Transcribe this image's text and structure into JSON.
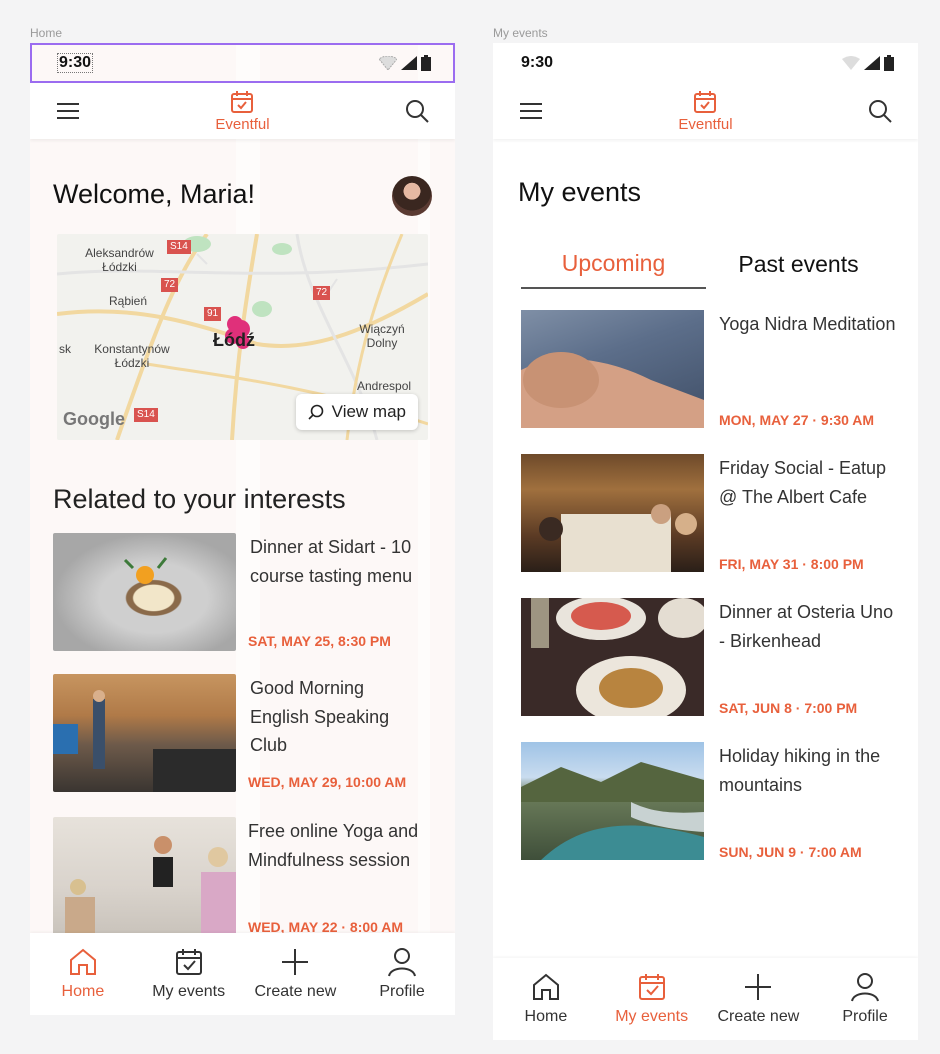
{
  "frames": {
    "home": "Home",
    "my_events": "My events"
  },
  "status": {
    "time": "9:30"
  },
  "app": {
    "name": "Eventful"
  },
  "home": {
    "welcome": "Welcome, Maria!",
    "map": {
      "labels": [
        "Aleksandrów Łódzki",
        "Rąbień",
        "sk",
        "Konstantynów Łódzki",
        "Wiączyń Dolny",
        "Andrespol"
      ],
      "roads": [
        "S14",
        "72",
        "72",
        "91",
        "S14"
      ],
      "city": "Łódź",
      "attribution": "Google",
      "view_map": "View map"
    },
    "section_title": "Related to your interests",
    "cards": [
      {
        "title": "Dinner at Sidart - 10 course tasting menu",
        "date": "SAT, MAY 25, 8:30 PM"
      },
      {
        "title": "Good Morning English Speaking Club",
        "date": "WED, MAY 29, 10:00 AM"
      },
      {
        "title": "Free online Yoga and Mindfulness session",
        "date": "WED, MAY 22 · 8:00 AM"
      }
    ]
  },
  "events": {
    "title": "My events",
    "tabs": [
      "Upcoming",
      "Past events"
    ],
    "cards": [
      {
        "title": "Yoga Nidra Meditation",
        "date": "MON, MAY 27 · 9:30 AM"
      },
      {
        "title": "Friday Social - Eatup @ The Albert Cafe",
        "date": "FRI, MAY 31 · 8:00 PM"
      },
      {
        "title": "Dinner at Osteria Uno - Birkenhead",
        "date": "SAT, JUN 8 · 7:00 PM"
      },
      {
        "title": "Holiday hiking in the mountains",
        "date": "SUN, JUN 9 · 7:00 AM"
      }
    ]
  },
  "nav": [
    "Home",
    "My events",
    "Create new",
    "Profile"
  ],
  "colors": {
    "accent": "#e8603c",
    "grid_outline": "#9b6cf0"
  },
  "icons": [
    "menu-icon",
    "calendar-check-icon",
    "search-icon",
    "home-icon",
    "plus-icon",
    "person-icon",
    "wifi-icon",
    "signal-icon",
    "battery-icon"
  ]
}
